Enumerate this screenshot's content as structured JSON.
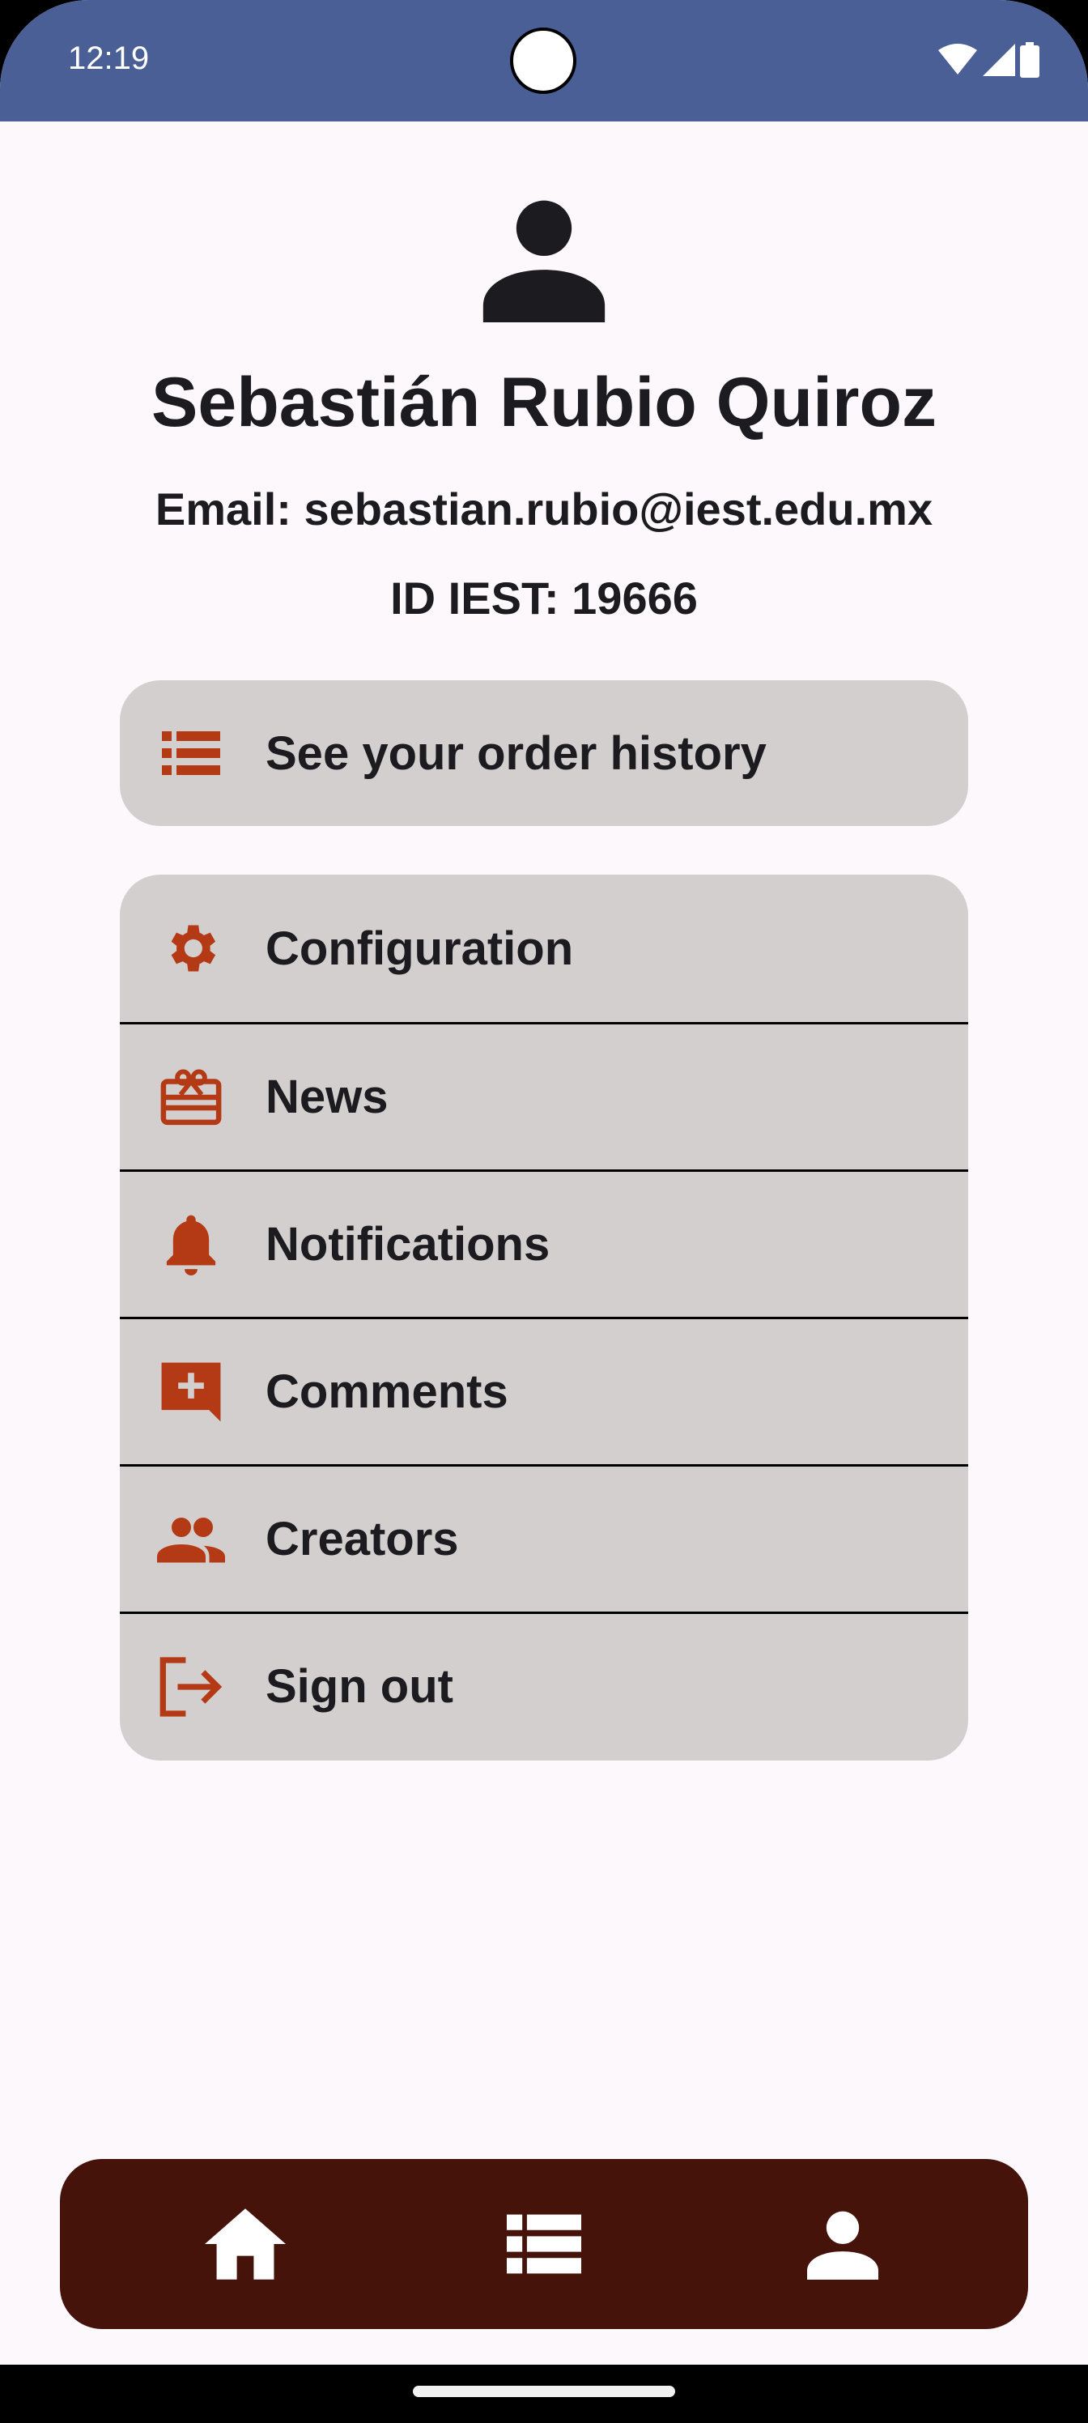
{
  "status_bar": {
    "time": "12:19"
  },
  "profile": {
    "name": "Sebastián Rubio Quiroz",
    "email": "Email: sebastian.rubio@iest.edu.mx",
    "id": "ID IEST: 19666",
    "avatar_icon": "person-icon"
  },
  "history": {
    "label": "See your order history",
    "icon": "list-icon"
  },
  "menu": {
    "items": [
      {
        "label": "Configuration",
        "icon": "gear-icon"
      },
      {
        "label": "News",
        "icon": "gift-card-icon"
      },
      {
        "label": "Notifications",
        "icon": "bell-icon"
      },
      {
        "label": "Comments",
        "icon": "add-comment-icon"
      },
      {
        "label": "Creators",
        "icon": "people-icon"
      },
      {
        "label": "Sign out",
        "icon": "logout-icon"
      }
    ]
  },
  "bottom_nav": {
    "items": [
      {
        "icon": "home-icon"
      },
      {
        "icon": "list-icon"
      },
      {
        "icon": "person-icon"
      }
    ]
  },
  "colors": {
    "status_bar": "#4a5f96",
    "background": "#fcf8fb",
    "card": "#d3cfcf",
    "accent_icon": "#b43a15",
    "text": "#1c1b1f",
    "bottom_nav": "#46130b"
  }
}
